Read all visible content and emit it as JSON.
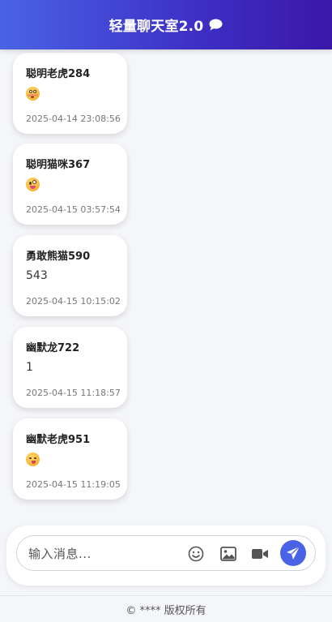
{
  "header": {
    "title": "轻量聊天室2.0",
    "icon": "chat-bubble-icon",
    "gradient": [
      "#4a63e6",
      "#3a17a8"
    ]
  },
  "messages": [
    {
      "sender": "聪明老虎284",
      "emoji": "flushed-face-emoji",
      "time": "2025-04-14 23:08:56"
    },
    {
      "sender": "聪明猫咪367",
      "emoji": "zany-face-emoji",
      "time": "2025-04-15 03:57:54"
    },
    {
      "sender": "勇敢熊猫590",
      "text": "543",
      "time": "2025-04-15 10:15:02"
    },
    {
      "sender": "幽默龙722",
      "text": "1",
      "time": "2025-04-15 11:18:57"
    },
    {
      "sender": "幽默老虎951",
      "emoji": "yum-face-emoji",
      "time": "2025-04-15 11:19:05"
    }
  ],
  "composer": {
    "placeholder": "输入消息...",
    "value": "",
    "tools": [
      "smiley-icon",
      "image-icon",
      "video-icon"
    ],
    "send_icon": "paper-plane-icon",
    "accent": "#4a63e6"
  },
  "footer": {
    "text": "© **** 版权所有"
  }
}
